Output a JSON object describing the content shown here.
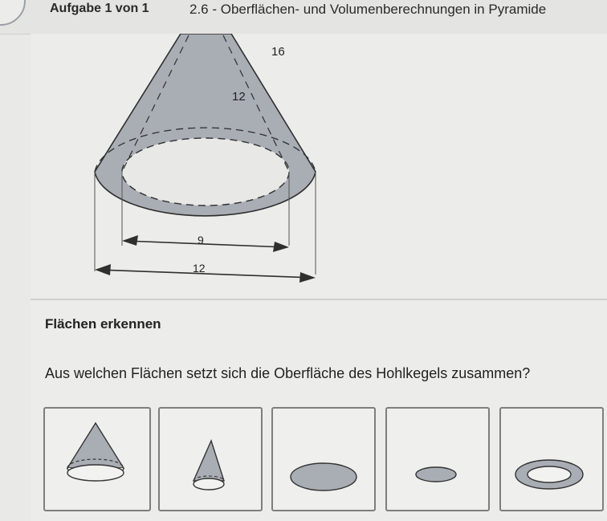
{
  "header": {
    "task_label": "Aufgabe 1 von 1",
    "title": "2.6 - Oberflächen- und Volumenberechnungen in Pyramide"
  },
  "figure": {
    "labels": {
      "slant_outer": "16",
      "slant_inner": "12",
      "diameter_inner": "9",
      "diameter_outer": "12"
    },
    "colors": {
      "solid_fill": "#a9adb4",
      "line": "#2f2f2f"
    }
  },
  "question": {
    "heading": "Flächen erkennen",
    "text": "Aus welchen Flächen setzt sich die Oberfläche des Hohlkegels zusammen?"
  },
  "options": [
    {
      "shape": "large-cone-icon"
    },
    {
      "shape": "small-cone-icon"
    },
    {
      "shape": "large-ellipse-icon"
    },
    {
      "shape": "small-ellipse-icon"
    },
    {
      "shape": "ring-icon"
    }
  ]
}
